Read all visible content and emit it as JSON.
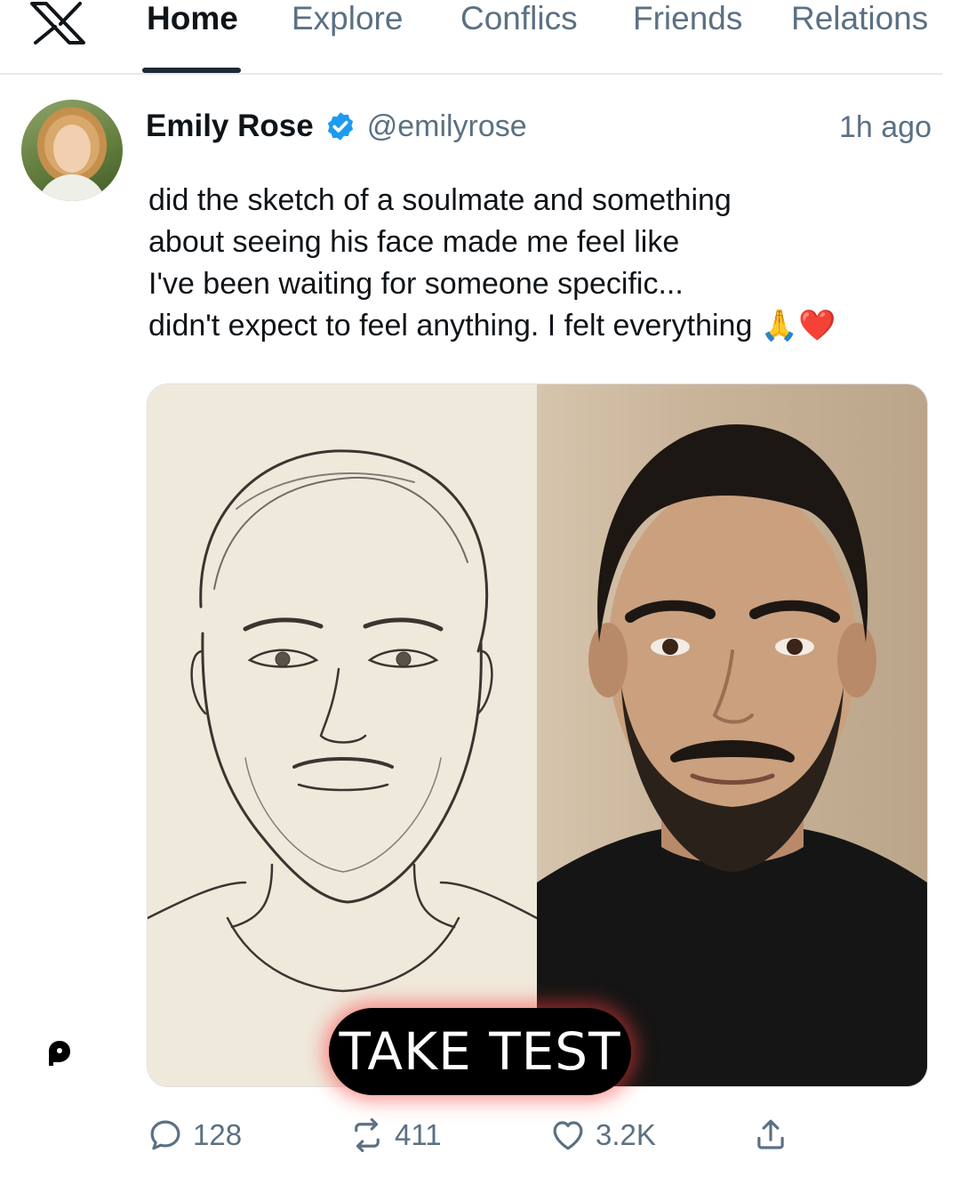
{
  "nav": {
    "logo_icon": "x-logo-icon",
    "tabs": [
      {
        "label": "Home",
        "active": true
      },
      {
        "label": "Explore"
      },
      {
        "label": "Conflics"
      },
      {
        "label": "Friends"
      },
      {
        "label": "Relations"
      }
    ]
  },
  "post": {
    "author": {
      "name": "Emily Rose",
      "handle": "@emilyrose",
      "verified_icon": "verified-badge-icon"
    },
    "time": "1h ago",
    "text_lines": [
      "did the sketch of a soulmate and something",
      "about seeing his face made me feel like",
      "I've been waiting for someone specific...",
      "didn't expect to feel anything. I felt everything 🙏❤️"
    ],
    "cta": "TAKE TEST"
  },
  "actions": {
    "replies": "128",
    "reposts": "411",
    "likes": "3.2K"
  },
  "colors": {
    "text": "#0f1419",
    "muted": "#5b7083",
    "verified": "#1d9bf0",
    "cta_glow": "#ff3c3c"
  }
}
